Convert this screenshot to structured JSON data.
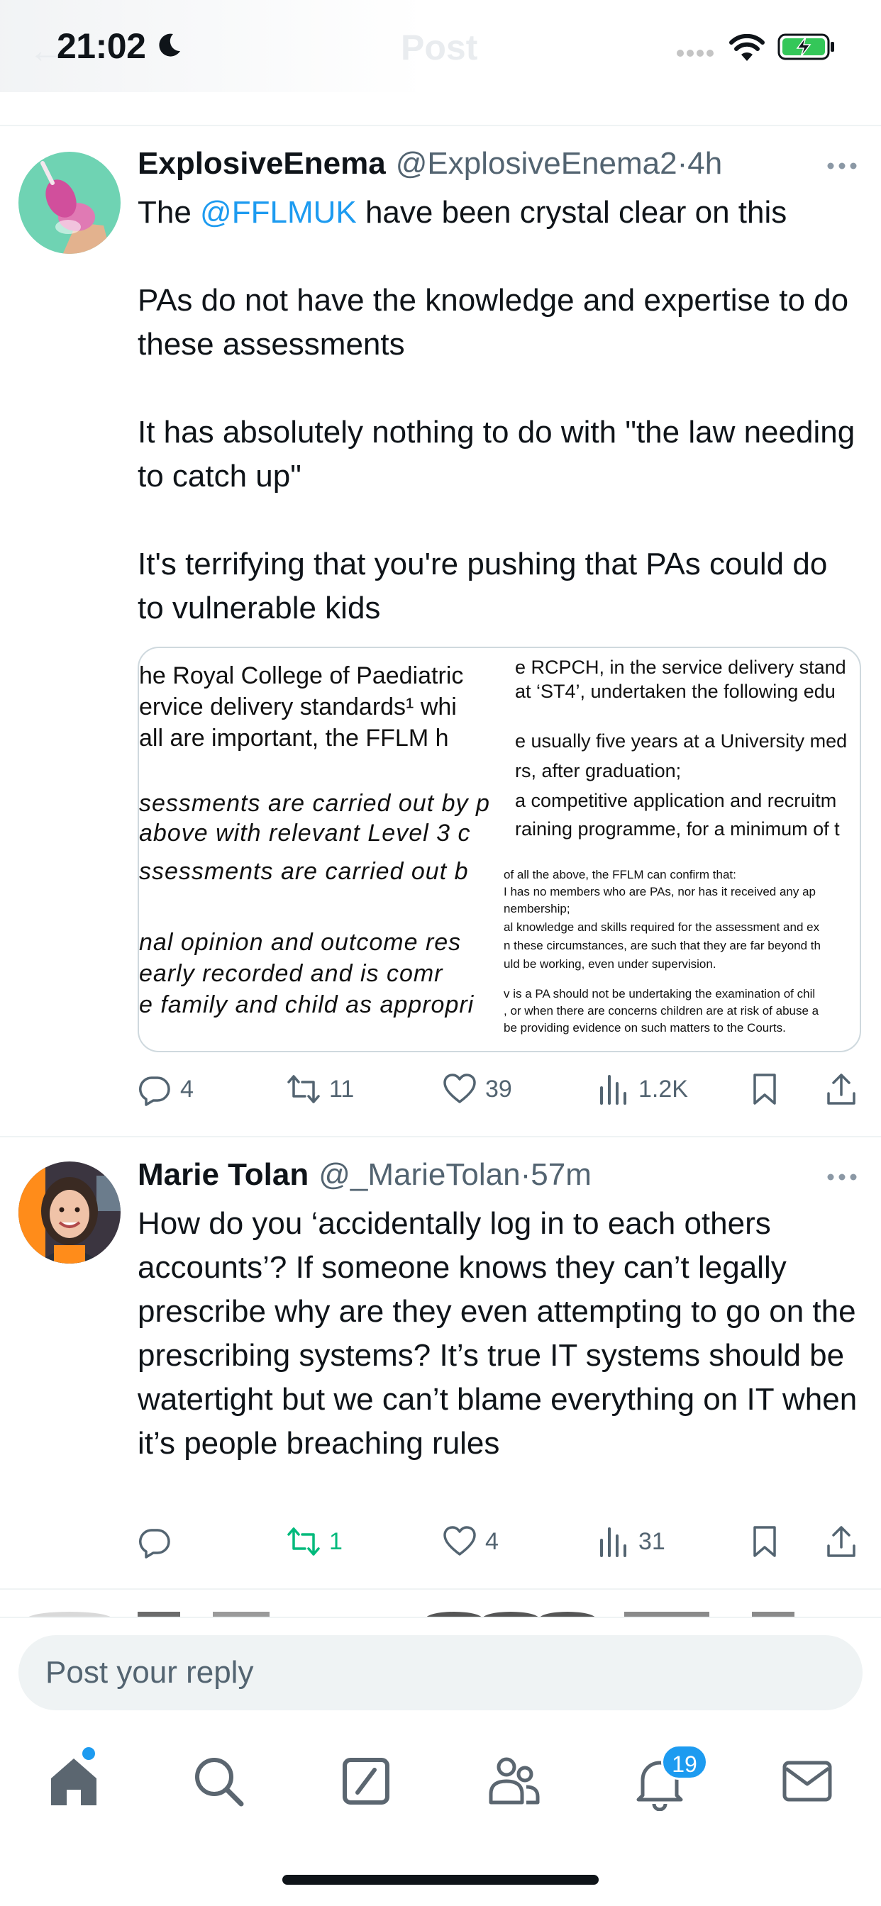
{
  "status_bar": {
    "time": "21:02",
    "header_title": "Post"
  },
  "tweets": [
    {
      "name": "ExplosiveEnema",
      "handle": "@ExplosiveEnema2",
      "separator": " · ",
      "time": "4h",
      "text_prefix": "The ",
      "mention": "@FFLMUK",
      "text_suffix": " have been crystal clear on this",
      "paragraphs": [
        "PAs do not have the knowledge and expertise to do these assessments",
        "It has absolutely nothing to do with \"the law needing to catch up\"",
        "It's terrifying that you're pushing that PAs could do to vulnerable kids"
      ],
      "media": {
        "left_lines": [
          "he Royal College of Paediatric",
          "ervice delivery standards¹ whi",
          " all are important, the FFLM h",
          "sessments are carried out by p",
          " above with relevant Level 3 c",
          "ssessments are carried out b",
          "nal opinion and outcome res",
          "early recorded and is comr",
          "e family and child as appropri"
        ],
        "right_lines_big": [
          "e RCPCH, in the service delivery stand",
          "at ‘ST4’, undertaken the following edu",
          "e usually five years at a University med",
          "rs, after graduation;",
          "a competitive application and recruitm",
          "raining programme, for a minimum of t"
        ],
        "right_lines_small": [
          "of all the above, the FFLM can confirm that:",
          "I has no members who are PAs, nor has it received any ap",
          "nembership;",
          "al knowledge and skills required for the assessment and ex",
          "n these circumstances, are such that they are far beyond th",
          "uld be working, even under supervision.",
          "v is a PA should not be undertaking the examination of chil",
          ", or when there are concerns children are at risk of abuse a",
          "be providing evidence on such matters to the Courts."
        ]
      },
      "stats": {
        "replies": "4",
        "reposts": "11",
        "likes": "39",
        "views": "1.2K"
      }
    },
    {
      "name": "Marie Tolan",
      "handle": "@_MarieTolan",
      "separator": " · ",
      "time": "57m",
      "text": "How do you ‘accidentally log in to each others accounts’? If someone knows they can’t legally prescribe why are they even attempting to go on the prescribing systems? It’s true IT systems should be watertight but we can’t blame everything on IT when it’s people breaching rules",
      "stats": {
        "replies": "",
        "reposts": "1",
        "likes": "4",
        "views": "31"
      }
    }
  ],
  "reply_bar": {
    "placeholder": "Post your reply"
  },
  "tab_bar": {
    "notifications_badge": "19"
  },
  "colors": {
    "accent": "#1d9bf0",
    "repost_active": "#00ba7c",
    "muted": "#536471",
    "text": "#0f1419"
  },
  "icons": [
    "moon-icon",
    "signal-icon",
    "wifi-icon",
    "battery-charging-icon",
    "more-icon",
    "reply-icon",
    "repost-icon",
    "like-icon",
    "views-icon",
    "bookmark-icon",
    "share-icon",
    "home-icon",
    "search-icon",
    "compose-icon",
    "communities-icon",
    "notifications-icon",
    "messages-icon"
  ]
}
